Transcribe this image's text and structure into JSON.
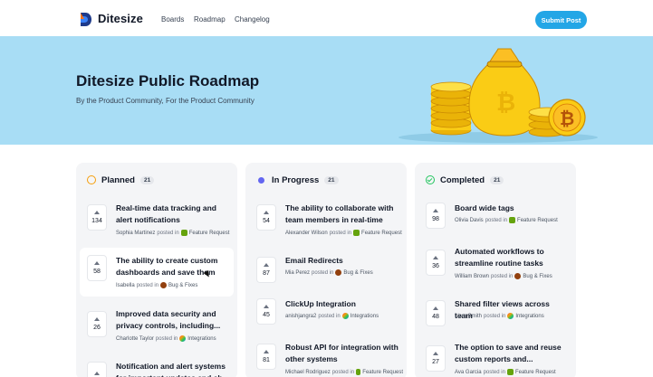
{
  "header": {
    "brand": "Ditesize",
    "nav": [
      "Boards",
      "Roadmap",
      "Changelog"
    ],
    "submit_label": "Submit Post"
  },
  "hero": {
    "title": "Ditesize Public Roadmap",
    "subtitle": "By the Product Community, For the Product Community"
  },
  "columns": [
    {
      "title": "Planned",
      "count": "21",
      "cards": [
        {
          "votes": "134",
          "title": "Real-time data tracking and alert notifications",
          "author": "Sophia Martinez",
          "posted": "posted in",
          "tag": "Feature Request"
        },
        {
          "votes": "58",
          "title": "The ability to create custom dashboards and save them fo...",
          "author": "Isabella",
          "posted": "posted in",
          "tag": "Bug & Fixes"
        },
        {
          "votes": "26",
          "title": "Improved data security and privacy controls, including...",
          "author": "Charlotte Taylor",
          "posted": "posted in",
          "tag": "Integrations"
        },
        {
          "votes": "",
          "title": "Notification and alert systems for important updates and ch...",
          "author": "",
          "posted": "",
          "tag": ""
        }
      ]
    },
    {
      "title": "In Progress",
      "count": "21",
      "cards": [
        {
          "votes": "54",
          "title": "The ability to collaborate with team members in real-time on...",
          "author": "Alexander Wilson",
          "posted": "posted in",
          "tag": "Feature Request"
        },
        {
          "votes": "87",
          "title": "Email Redirects",
          "author": "Mia Perez",
          "posted": "posted in",
          "tag": "Bug & Fixes"
        },
        {
          "votes": "45",
          "title": "ClickUp Integration",
          "author": "anishjangra2",
          "posted": "posted in",
          "tag": "Integrations"
        },
        {
          "votes": "81",
          "title": "Robust API for integration with other systems",
          "author": "Michael Rodriguez",
          "posted": "posted in",
          "tag": "Feature Request"
        }
      ]
    },
    {
      "title": "Completed",
      "count": "21",
      "cards": [
        {
          "votes": "98",
          "title": "Board wide tags",
          "author": "Olivia Davis",
          "posted": "posted in",
          "tag": "Feature Request"
        },
        {
          "votes": "36",
          "title": "Automated workflows to streamline routine tasks",
          "author": "William Brown",
          "posted": "posted in",
          "tag": "Bug & Fixes"
        },
        {
          "votes": "48",
          "title": "Shared filter views across team",
          "author": "Liam Smith",
          "posted": "posted in",
          "tag": "Integrations"
        },
        {
          "votes": "27",
          "title": "The option to save and reuse custom reports and...",
          "author": "Ava Garcia",
          "posted": "posted in",
          "tag": "Feature Request"
        }
      ]
    }
  ],
  "colors": {
    "accent": "#23a6e6",
    "hero_bg": "#a8ddf5",
    "planned": "#f59e0b",
    "in_progress": "#6366f1",
    "completed": "#22c55e"
  },
  "icons": {
    "logo": "ditesize-logo",
    "vote": "upvote-arrow-icon",
    "hero_art": "money-bag-and-coins-illustration"
  }
}
